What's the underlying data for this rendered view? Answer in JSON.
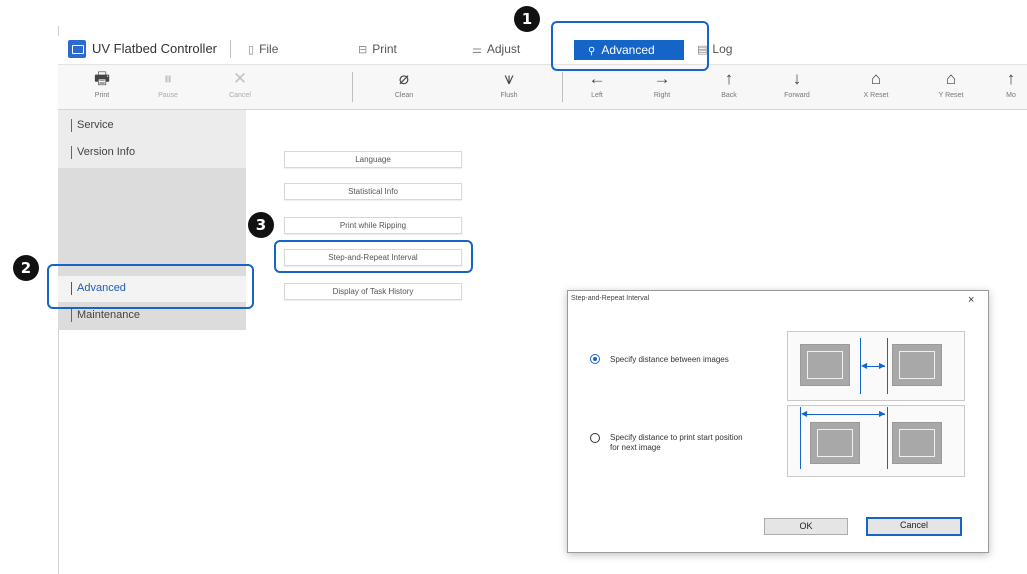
{
  "app": {
    "title": "UV Flatbed Controller"
  },
  "menu": [
    {
      "label": "File",
      "icon": "file-icon"
    },
    {
      "label": "Print",
      "icon": "print-icon"
    },
    {
      "label": "Adjust",
      "icon": "adjust-icon"
    },
    {
      "label": "Advanced",
      "icon": "advanced-icon",
      "active": true
    },
    {
      "label": "Log",
      "icon": "log-icon"
    }
  ],
  "toolbar": [
    {
      "label": "Print",
      "icon": "printer-icon",
      "enabled": true
    },
    {
      "label": "Pause",
      "icon": "pause-icon",
      "enabled": false
    },
    {
      "label": "Cancel",
      "icon": "cancel-icon",
      "enabled": false
    },
    {
      "label": "Clean",
      "icon": "clean-icon",
      "enabled": true
    },
    {
      "label": "Flush",
      "icon": "flush-icon",
      "enabled": true
    },
    {
      "label": "Left",
      "icon": "arrow-left-icon",
      "enabled": true
    },
    {
      "label": "Right",
      "icon": "arrow-right-icon",
      "enabled": true
    },
    {
      "label": "Back",
      "icon": "arrow-up-icon",
      "enabled": true
    },
    {
      "label": "Forward",
      "icon": "arrow-down-icon",
      "enabled": true
    },
    {
      "label": "X Reset",
      "icon": "home-x-icon",
      "enabled": true
    },
    {
      "label": "Y Reset",
      "icon": "home-y-icon",
      "enabled": true
    },
    {
      "label": "Mo",
      "icon": "more-icon",
      "enabled": true
    }
  ],
  "sidebar": {
    "items": [
      {
        "label": "Service"
      },
      {
        "label": "Version Info"
      },
      {
        "label": "Advanced",
        "active": true
      },
      {
        "label": "Maintenance"
      }
    ]
  },
  "main": {
    "buttons": [
      {
        "label": "Language"
      },
      {
        "label": "Statistical Info"
      },
      {
        "label": "Print while Ripping"
      },
      {
        "label": "Step-and-Repeat Interval"
      },
      {
        "label": "Display of Task History"
      }
    ]
  },
  "callouts": {
    "one": "1",
    "two": "2",
    "three": "3"
  },
  "dialog": {
    "title": "Step-and-Repeat Interval",
    "close": "×",
    "option1": "Specify distance between images",
    "option2_line1": "Specify distance to print start position",
    "option2_line2": "for next image",
    "selected": "option1",
    "ok": "OK",
    "cancel": "Cancel"
  },
  "colors": {
    "accent": "#1565c8",
    "callout": "#1565c8",
    "sidebar": "#dcdcdc"
  }
}
